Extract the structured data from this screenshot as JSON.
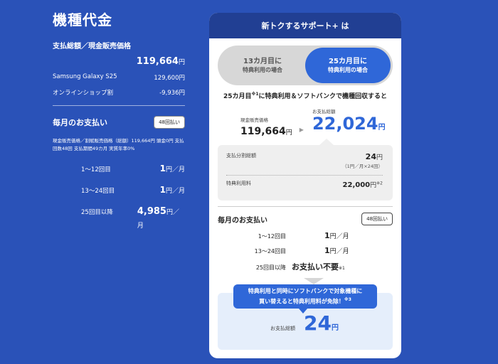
{
  "left": {
    "title": "機種代金",
    "subtitle": "支払総額／現金販売価格",
    "total": "119,664",
    "yen": "円",
    "rows": [
      {
        "label": "Samsung Galaxy S25",
        "value": "129,600円"
      },
      {
        "label": "オンラインショップ割",
        "value": "-9,936円"
      }
    ],
    "monthly_title": "毎月のお支払い",
    "installments_badge": "48回払い",
    "note": "現金販売価格／割賦販売価格（総額）119,664円 頭金0円 支払回数48回 支払期間49カ月 実質年率0%",
    "payments": [
      {
        "label": "1〜12回目",
        "value": "1",
        "unit": "円／月"
      },
      {
        "label": "13〜24回目",
        "value": "1",
        "unit": "円／月"
      },
      {
        "label": "25回目以降",
        "value": "4,985",
        "unit": "円／月"
      }
    ]
  },
  "card": {
    "header": "新トクするサポート+ は",
    "toggle": [
      {
        "a": "13カ月目に",
        "b": "特典利用の場合"
      },
      {
        "a": "25カ月目に",
        "b": "特典利用の場合"
      }
    ],
    "condition_pre": "25カ月目",
    "condition_note": "※1",
    "condition_post": "に特典利用＆ソフトバンクで機種回収すると",
    "cash_label": "現金販売価格",
    "cash_value": "119,664",
    "cash_unit": "円",
    "arrow": "▶",
    "total_label": "お支払総額",
    "total_value": "22,024",
    "total_unit": "円",
    "installment_label": "支払分割総額",
    "installment_value": "24",
    "installment_unit": "円",
    "installment_detail": "（1円／月×24回）",
    "fee_label": "特典利用料",
    "fee_value": "22,000",
    "fee_unit": "円",
    "fee_note": "※2",
    "monthly_title": "毎月のお支払い",
    "installments_badge": "48回払い",
    "payments": [
      {
        "label": "1〜12回目",
        "value": "1",
        "unit": "円／月"
      },
      {
        "label": "13〜24回目",
        "value": "1",
        "unit": "円／月"
      },
      {
        "label": "25回目以降",
        "value": "お支払い不要",
        "unit": "※1"
      }
    ],
    "bubble_line1": "特典利用と同時にソフトバンクで対象機種に",
    "bubble_line2": "買い替えると特典利用料が免除！",
    "bubble_note": "※3",
    "final_label": "お支払総額",
    "final_value": "24",
    "final_unit": "円"
  }
}
